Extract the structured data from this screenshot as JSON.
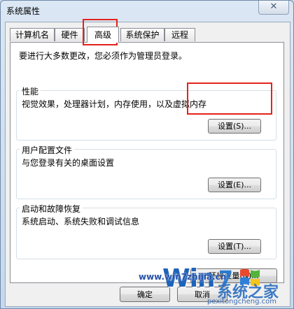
{
  "window": {
    "title": "系统属性",
    "close_glyph": "✕"
  },
  "tabs": [
    {
      "label": "计算机名"
    },
    {
      "label": "硬件"
    },
    {
      "label": "高级",
      "active": true
    },
    {
      "label": "系统保护"
    },
    {
      "label": "远程"
    }
  ],
  "admin_note": "要进行大多数更改，您必须作为管理员登录。",
  "performance": {
    "title": "性能",
    "description": "视觉效果，处理器计划，内存使用，以及虚拟内存",
    "button": "设置(S)..."
  },
  "user_profiles": {
    "title": "用户配置文件",
    "description": "与您登录有关的桌面设置",
    "button": "设置(E)..."
  },
  "startup_recovery": {
    "title": "启动和故障恢复",
    "description": "系统启动、系统失败和调试信息",
    "button": "设置(T)..."
  },
  "env_button": "环境变量(N)...",
  "footer": {
    "ok": "确定",
    "cancel": "取消"
  },
  "watermark": {
    "brand_main": "Win",
    "brand_number": "7",
    "site_name": "系统之家",
    "url": "www.win7zhijia.cn",
    "pinyin": "pexitongcheng.com"
  },
  "colors": {
    "highlight": "#e3231c",
    "watermark": "#1f63b8"
  }
}
